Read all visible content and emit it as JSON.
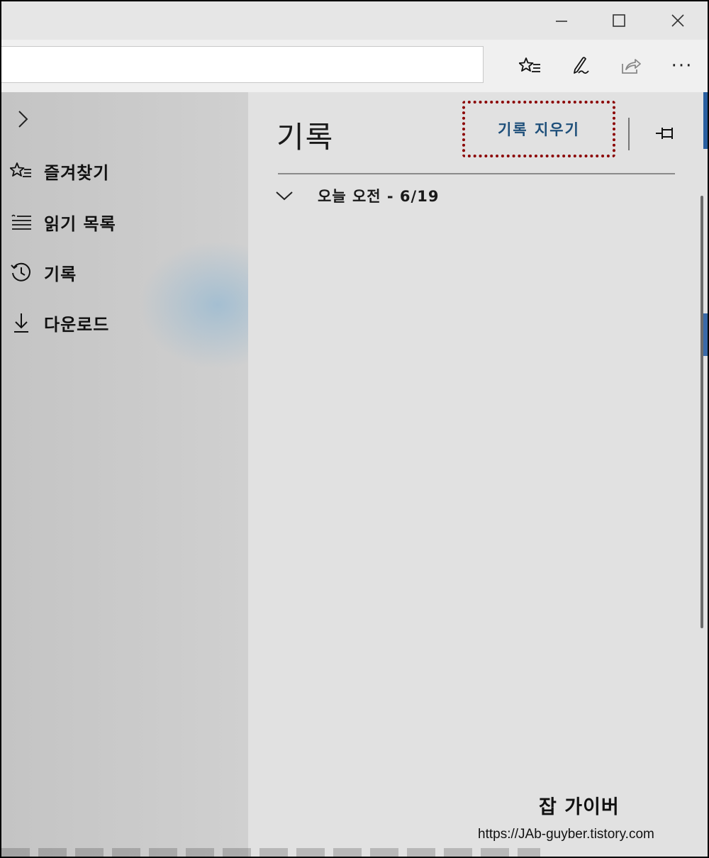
{
  "window": {
    "minimize_icon": "minimize-icon",
    "maximize_icon": "maximize-icon",
    "close_icon": "close-icon"
  },
  "toolbar": {
    "address_value": "",
    "favorites_icon": "favorites-list-icon",
    "notes_icon": "pen-icon",
    "share_icon": "share-icon",
    "more_label": "···"
  },
  "hub": {
    "collapse_icon": "chevron-right-icon",
    "items": [
      {
        "label": "즐겨찾기",
        "icon": "star-list-icon"
      },
      {
        "label": "읽기 목록",
        "icon": "reading-list-icon"
      },
      {
        "label": "기록",
        "icon": "history-icon"
      },
      {
        "label": "다운로드",
        "icon": "download-icon"
      }
    ]
  },
  "history": {
    "title": "기록",
    "clear_label": "기록 지우기",
    "pin_icon": "pin-icon",
    "groups": [
      {
        "label": "오늘 오전 - 6/19",
        "icon": "chevron-down-icon"
      }
    ]
  },
  "watermark": {
    "name": "잡 가이버",
    "url": "https://JAb-guyber.tistory.com"
  },
  "colors": {
    "accent_link": "#1e4f7a",
    "highlight_border": "#8b0000"
  }
}
